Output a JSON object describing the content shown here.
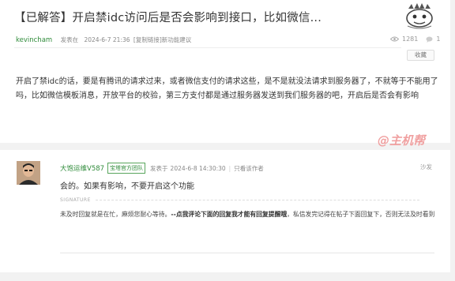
{
  "post": {
    "title": "【已解答】开启禁idc访问后是否会影响到接口，比如微信...",
    "author": "kevincham",
    "posted_label": "发表在",
    "date": "2024-6-7 21:36",
    "category": "[复制链接]新功能建议",
    "views": "1281",
    "replies": "1",
    "fav_label": "收藏",
    "body": "开启了禁idc的话，要是有腾讯的请求过来，或者微信支付的请求这些，是不是就没法请求到服务器了，不就等于不能用了吗，比如微信模板消息，开放平台的校验，第三方支付都是通过服务器发送到我们服务器的吧，开启后是否会有影响"
  },
  "watermark": "@主机帮",
  "reply": {
    "author": "大饱运维V587",
    "badge": "宝塔官方团队",
    "posted_label": "发表于",
    "date": "2024-6-8 14:30:30",
    "separator": "|",
    "only_author": "只看该作者",
    "floor": "沙发",
    "content": "会的。如果有影响，不要开启这个功能",
    "signature_label": "SIGNATURE",
    "signature_pre": "未及时回复就是在忙，麻烦您耐心等待。",
    "signature_bold": "--点我评论下面的回复我才能有回复提醒哦",
    "signature_post": "，私信发完记得在帖子下面回复下，否则无法及时看到"
  },
  "colors": {
    "author_green": "#2f8b3a",
    "watermark": "#f0a0a0",
    "background": "#f2f2f2"
  },
  "icons": [
    "eye-icon",
    "comment-icon",
    "site-logo-icon"
  ]
}
